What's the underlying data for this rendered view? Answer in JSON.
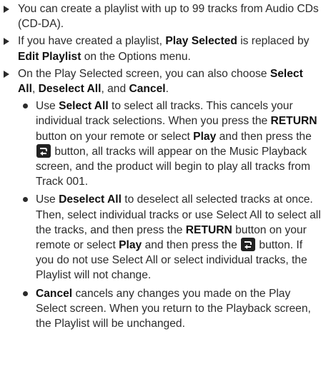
{
  "bullets": [
    {
      "t1": "You can create a playlist with up to 99 tracks from Audio CDs (CD-DA)."
    },
    {
      "t1": "If you have created a playlist, ",
      "b1": "Play Selected",
      "t2": " is replaced by ",
      "b2": "Edit Playlist",
      "t3": " on the Options menu."
    },
    {
      "t1": "On the Play Selected screen, you can also choose ",
      "b1": "Select All",
      "t2": ", ",
      "b2": "Deselect All",
      "t3": ", and ",
      "b3": "Cancel",
      "t4": "."
    }
  ],
  "sub_bullets": [
    {
      "t1": "Use ",
      "b1": "Select All",
      "t2": " to select all tracks. This cancels your individual track selections. When you press the ",
      "b2": "RETURN",
      "t3": " button on your remote or select ",
      "b3": "Play",
      "t4": " and then press the ",
      "icon": "enter-icon",
      "t5": " button, all tracks will appear on the Music Playback screen, and the product will begin to play all tracks from Track 001."
    },
    {
      "t1": "Use ",
      "b1": "Deselect All",
      "t2": " to deselect all selected tracks at once. Then, select individual tracks or use Select All to select all the tracks, and then press the ",
      "b2": "RETURN",
      "t3": " button on your remote or select ",
      "b3": "Play",
      "t4": " and then press the ",
      "icon": "enter-icon",
      "t5": " button. If you do not use Select All or select individual tracks, the Playlist will not change."
    },
    {
      "b1": "Cancel",
      "t1": " cancels any changes you made on the Play Select screen. When you return to the Playback screen, the Playlist will be unchanged."
    }
  ]
}
